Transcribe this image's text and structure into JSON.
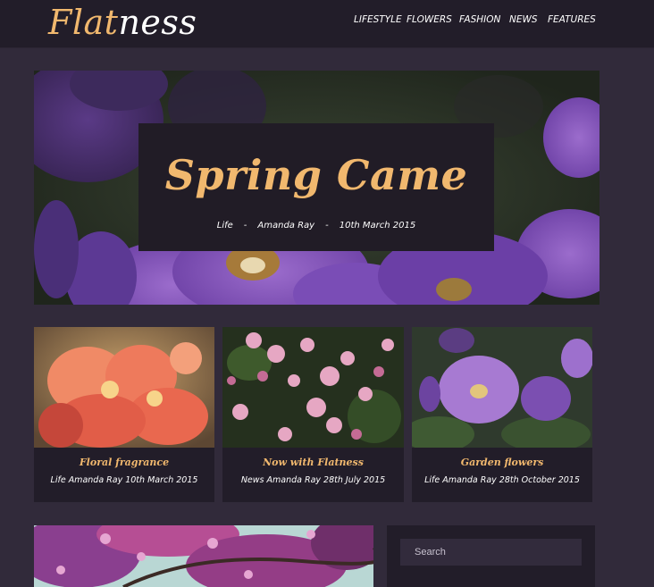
{
  "header": {
    "logo_part1": "Flat",
    "logo_part2": "ness",
    "nav": [
      "LIFESTYLE",
      "FLOWERS",
      "FASHION",
      "NEWS",
      "FEATURES"
    ]
  },
  "hero": {
    "title": "Spring Came",
    "category": "Life",
    "separator": "-",
    "author": "Amanda Ray",
    "date": "10th March 2015"
  },
  "posts": [
    {
      "title": "Floral fragrance",
      "meta": "Life Amanda Ray 10th March 2015"
    },
    {
      "title": "Now with Flatness",
      "meta": "News Amanda Ray 28th July 2015"
    },
    {
      "title": "Garden flowers",
      "meta": "Life Amanda Ray 28th October 2015"
    }
  ],
  "sidebar": {
    "search_placeholder": "Search"
  },
  "colors": {
    "background": "#312a3a",
    "panel": "#221d29",
    "accent": "#f1b86e"
  }
}
